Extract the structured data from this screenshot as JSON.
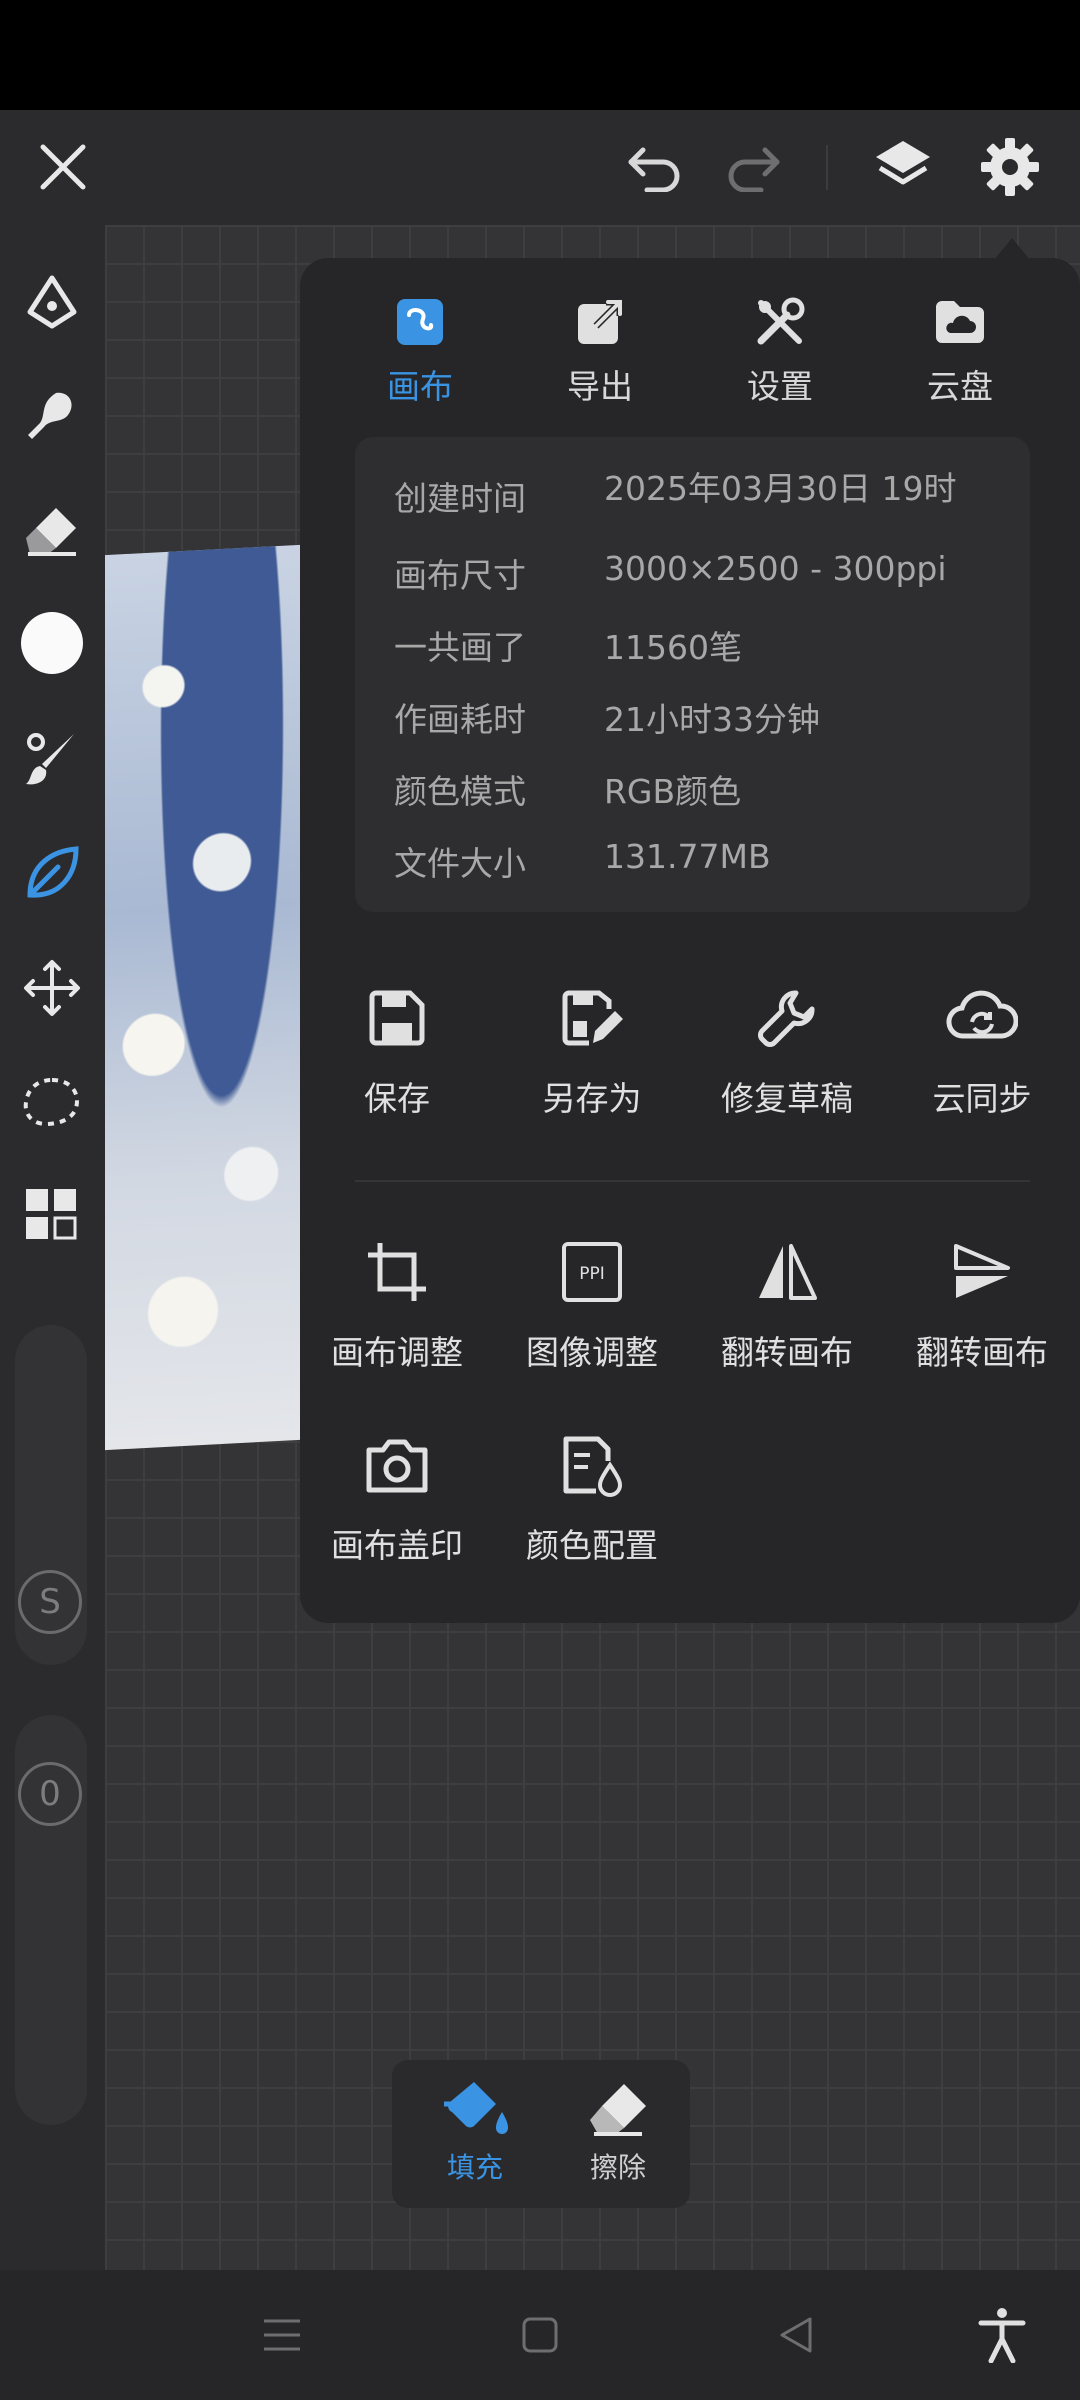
{
  "tabs": [
    {
      "label": "画布",
      "icon": "canvas-icon",
      "active": true
    },
    {
      "label": "导出",
      "icon": "export-icon",
      "active": false
    },
    {
      "label": "设置",
      "icon": "settings-tools-icon",
      "active": false
    },
    {
      "label": "云盘",
      "icon": "cloud-drive-icon",
      "active": false
    }
  ],
  "info": [
    {
      "key": "创建时间",
      "value": "2025年03月30日 19时"
    },
    {
      "key": "画布尺寸",
      "value": "3000×2500 - 300ppi"
    },
    {
      "key": "一共画了",
      "value": "11560笔"
    },
    {
      "key": "作画耗时",
      "value": "21小时33分钟"
    },
    {
      "key": "颜色模式",
      "value": "RGB颜色"
    },
    {
      "key": "文件大小",
      "value": "131.77MB"
    }
  ],
  "actions_row1": [
    {
      "label": "保存",
      "icon": "save-icon"
    },
    {
      "label": "另存为",
      "icon": "save-as-icon"
    },
    {
      "label": "修复草稿",
      "icon": "wrench-icon"
    },
    {
      "label": "云同步",
      "icon": "cloud-sync-icon"
    }
  ],
  "actions_row2": [
    {
      "label": "画布调整",
      "icon": "crop-icon"
    },
    {
      "label": "图像调整",
      "icon": "ppi-icon"
    },
    {
      "label": "翻转画布",
      "icon": "flip-horizontal-icon"
    },
    {
      "label": "翻转画布",
      "icon": "flip-vertical-icon"
    }
  ],
  "actions_row3": [
    {
      "label": "画布盖印",
      "icon": "camera-icon"
    },
    {
      "label": "颜色配置",
      "icon": "color-profile-icon"
    }
  ],
  "sidebar_badges": {
    "s": "S",
    "zero": "0"
  },
  "bottom_tools": [
    {
      "label": "填充",
      "icon": "fill-bucket-icon",
      "active": true
    },
    {
      "label": "擦除",
      "icon": "eraser-icon",
      "active": false
    }
  ],
  "colors": {
    "accent": "#3b94e3",
    "panel": "#262628",
    "background": "#2a2a2c"
  }
}
